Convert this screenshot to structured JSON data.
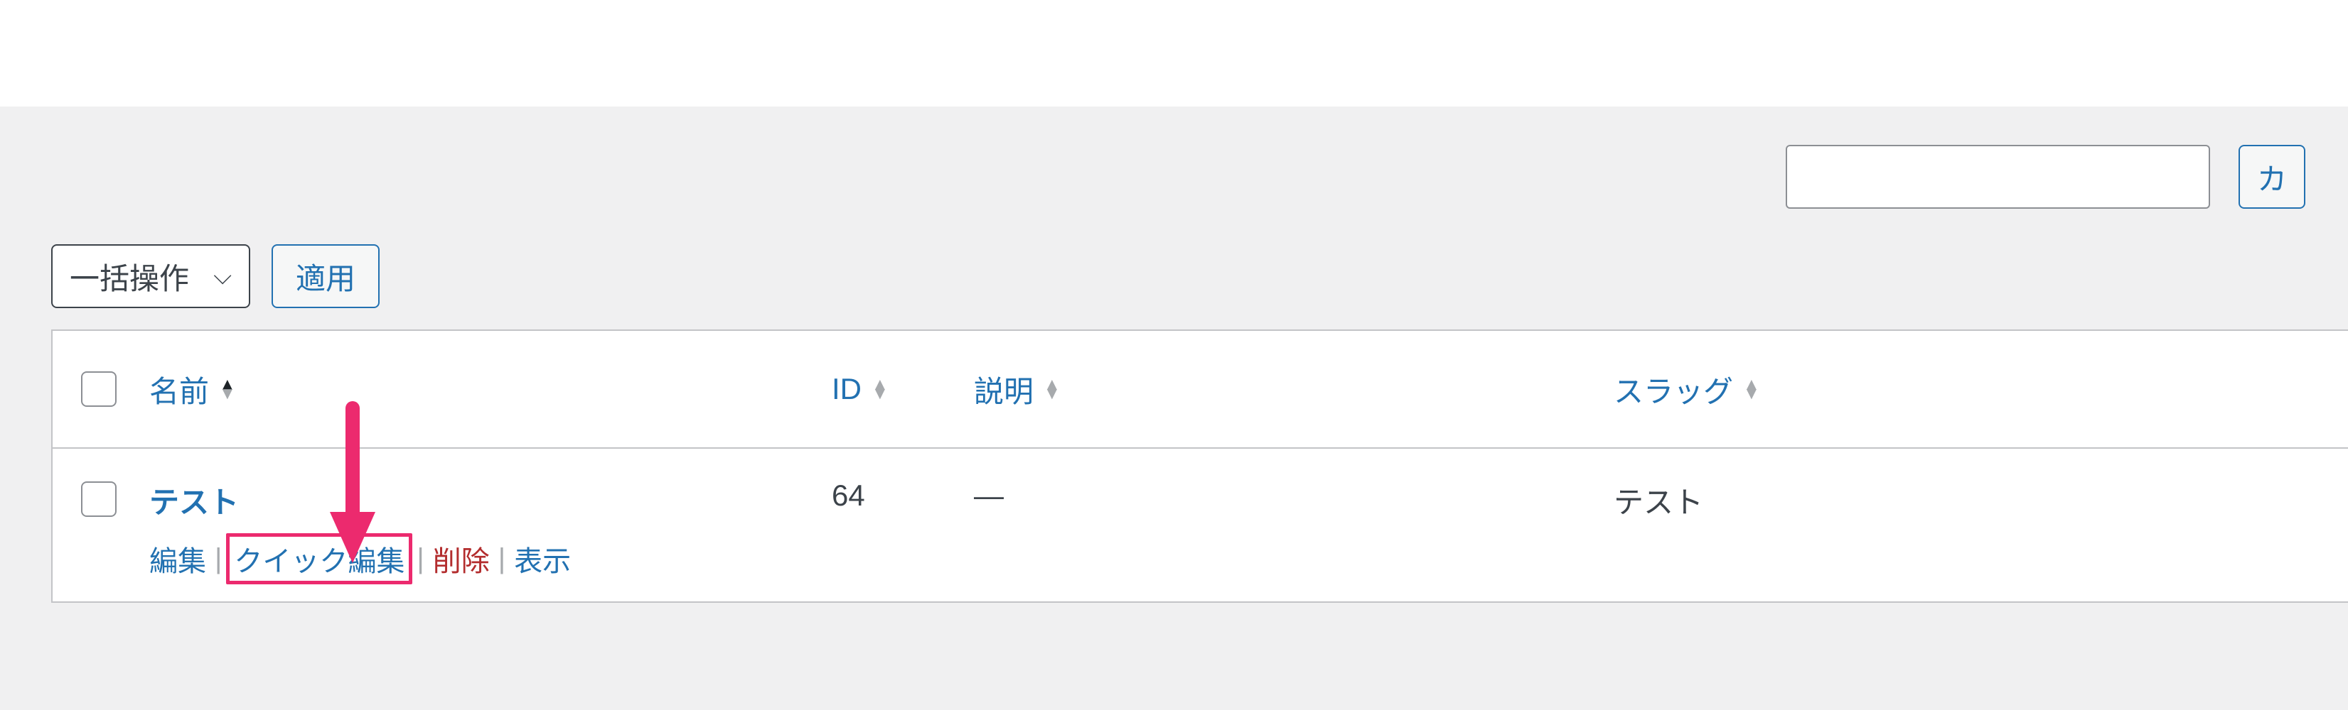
{
  "search": {
    "value": "",
    "button_label": "カ"
  },
  "bulk_actions": {
    "label": "一括操作",
    "apply_label": "適用"
  },
  "columns": {
    "name": "名前",
    "id": "ID",
    "description": "説明",
    "slug": "スラッグ"
  },
  "rows": [
    {
      "name": "テスト",
      "id": "64",
      "description": "—",
      "slug": "テスト",
      "actions": {
        "edit": "編集",
        "quick_edit": "クイック編集",
        "delete": "削除",
        "view": "表示"
      }
    }
  ],
  "sep": "|"
}
